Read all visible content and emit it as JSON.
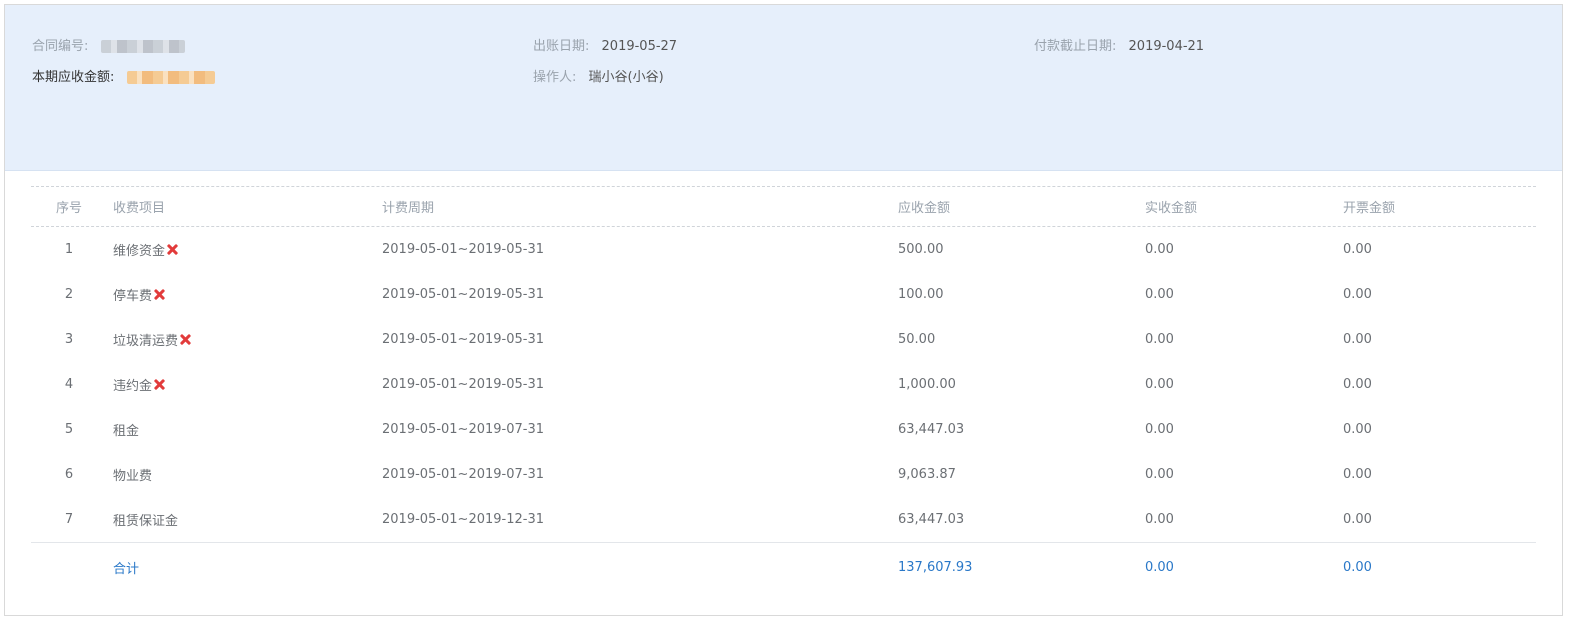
{
  "header": {
    "contract_no": {
      "label": "合同编号:",
      "value": ""
    },
    "bill_date": {
      "label": "出账日期:",
      "value": "2019-05-27"
    },
    "due_date": {
      "label": "付款截止日期:",
      "value": "2019-04-21"
    },
    "receivable": {
      "label": "本期应收金额:",
      "value": ""
    },
    "operator": {
      "label": "操作人:",
      "value": "瑞小谷(小谷)"
    }
  },
  "table": {
    "columns": [
      "序号",
      "收费项目",
      "计费周期",
      "应收金额",
      "实收金额",
      "开票金额"
    ],
    "rows": [
      {
        "idx": "1",
        "item": "维修资金",
        "period": "2019-05-01~2019-05-31",
        "receivable": "500.00",
        "received": "0.00",
        "invoiced": "0.00",
        "deletable": true
      },
      {
        "idx": "2",
        "item": "停车费",
        "period": "2019-05-01~2019-05-31",
        "receivable": "100.00",
        "received": "0.00",
        "invoiced": "0.00",
        "deletable": true
      },
      {
        "idx": "3",
        "item": "垃圾清运费",
        "period": "2019-05-01~2019-05-31",
        "receivable": "50.00",
        "received": "0.00",
        "invoiced": "0.00",
        "deletable": true
      },
      {
        "idx": "4",
        "item": "违约金",
        "period": "2019-05-01~2019-05-31",
        "receivable": "1,000.00",
        "received": "0.00",
        "invoiced": "0.00",
        "deletable": true
      },
      {
        "idx": "5",
        "item": "租金",
        "period": "2019-05-01~2019-07-31",
        "receivable": "63,447.03",
        "received": "0.00",
        "invoiced": "0.00",
        "deletable": false
      },
      {
        "idx": "6",
        "item": "物业费",
        "period": "2019-05-01~2019-07-31",
        "receivable": "9,063.87",
        "received": "0.00",
        "invoiced": "0.00",
        "deletable": false
      },
      {
        "idx": "7",
        "item": "租赁保证金",
        "period": "2019-05-01~2019-12-31",
        "receivable": "63,447.03",
        "received": "0.00",
        "invoiced": "0.00",
        "deletable": false
      }
    ],
    "total": {
      "label": "合计",
      "receivable": "137,607.93",
      "received": "0.00",
      "invoiced": "0.00"
    }
  },
  "colors": {
    "header_bg": "#e6effb",
    "total_text": "#2a78c8",
    "delete_icon": "#e23b3b"
  },
  "icons": {
    "delete": "close-x-icon"
  }
}
